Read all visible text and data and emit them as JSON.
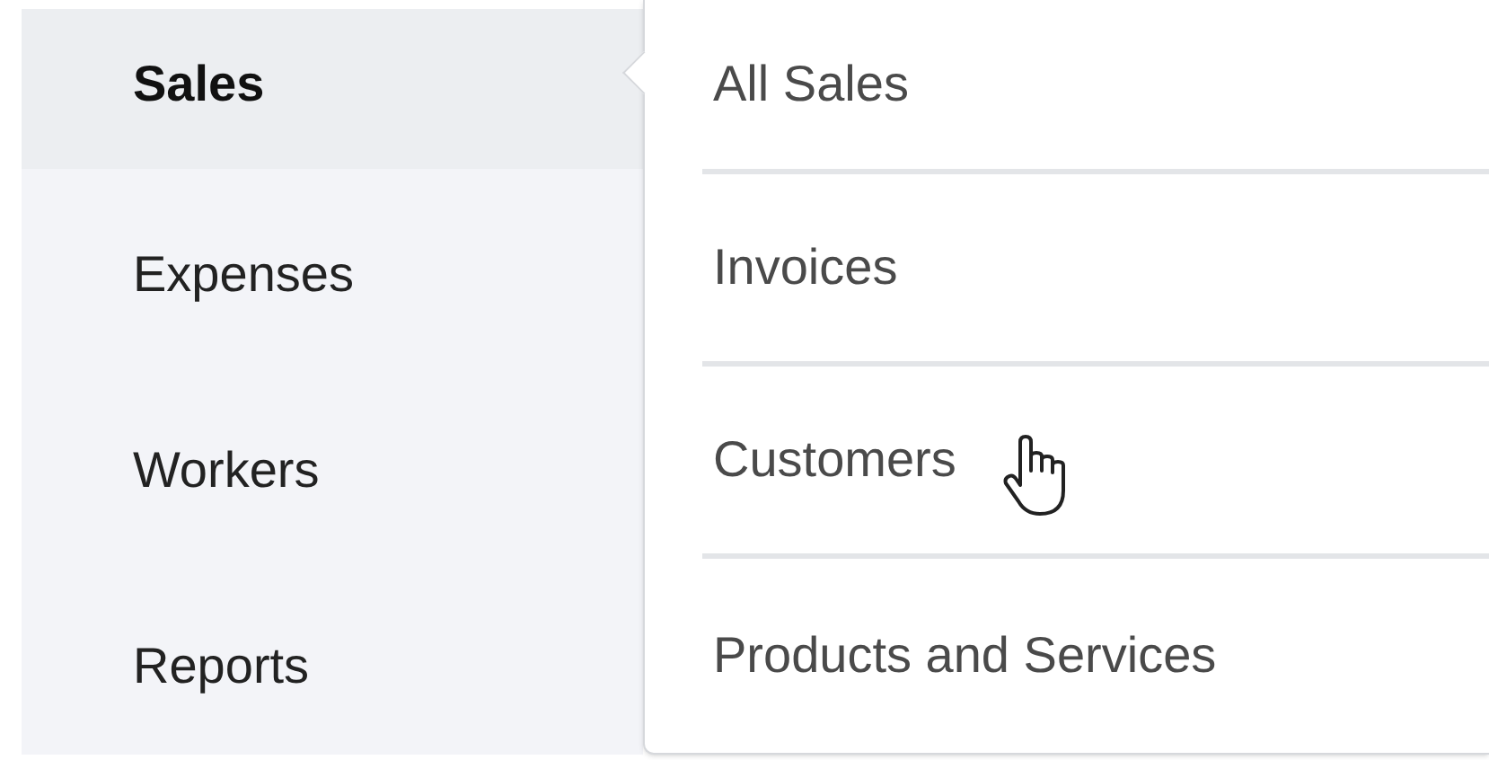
{
  "sidebar": {
    "items": [
      {
        "label": "Sales",
        "selected": true
      },
      {
        "label": "Expenses",
        "selected": false
      },
      {
        "label": "Workers",
        "selected": false
      },
      {
        "label": "Reports",
        "selected": false
      }
    ]
  },
  "flyout": {
    "items": [
      {
        "label": "All Sales"
      },
      {
        "label": "Invoices"
      },
      {
        "label": "Customers"
      },
      {
        "label": "Products and Services"
      }
    ]
  }
}
